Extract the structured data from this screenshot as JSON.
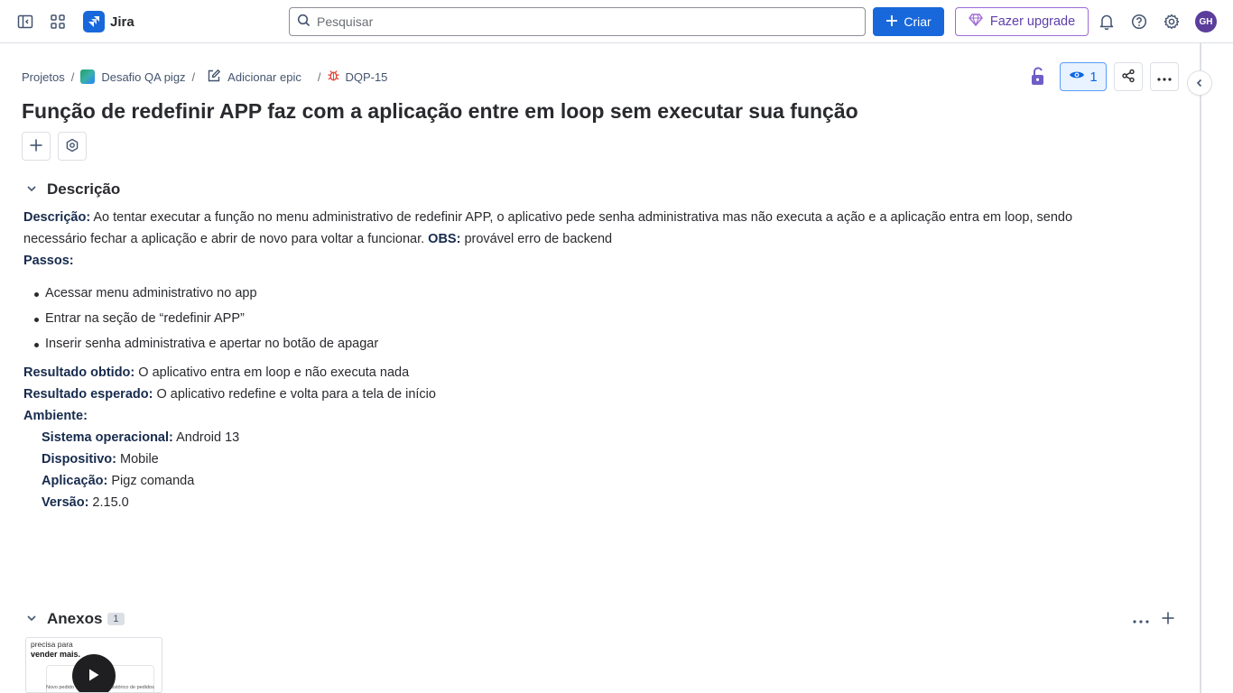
{
  "topbar": {
    "app_name": "Jira",
    "search_placeholder": "Pesquisar",
    "create_label": "Criar",
    "upgrade_label": "Fazer upgrade",
    "avatar_initials": "GH",
    "brand_color": "#1868db"
  },
  "breadcrumb": {
    "projects": "Projetos",
    "project": "Desafio QA pigz",
    "epic": "Adicionar epic",
    "issue_key": "DQP-15"
  },
  "actions": {
    "watchers_count": "1"
  },
  "issue": {
    "title": "Função de redefinir APP faz com a aplicação entre em loop sem executar sua função"
  },
  "description": {
    "heading": "Descrição",
    "desc_label": "Descrição:",
    "desc_text": " Ao tentar executar a função no menu administrativo de redefinir APP, o aplicativo pede senha administrativa mas não executa a ação e a aplicação entra em loop, sendo necessário fechar a aplicação e abrir de novo para voltar a funcionar.",
    "obs_label": "OBS:",
    "obs_text": " provável erro de backend",
    "steps_label": "Passos:",
    "steps": [
      "Acessar menu administrativo no app",
      "Entrar na seção de “redefinir APP”",
      "Inserir senha administrativa e apertar no botão de apagar"
    ],
    "obtained_label": "Resultado obtido:",
    "obtained_text": " O aplicativo entra em loop e não executa nada",
    "expected_label": "Resultado esperado:",
    "expected_text": " O aplicativo redefine e volta para a tela de início",
    "env_label": "Ambiente:",
    "os_label": "Sistema operacional:",
    "os_value": " Android 13",
    "device_label": "Dispositivo:",
    "device_value": " Mobile",
    "app_label": "Aplicação:",
    "app_value": " Pigz comanda",
    "version_label": "Versão:",
    "version_value": " 2.15.0"
  },
  "attachments": {
    "heading": "Anexos",
    "count": "1",
    "thumb_line1": "precisa para",
    "thumb_line2": "vender mais.",
    "thumb_caption1": "Novo pedido",
    "thumb_caption2": "Histórico de pedidos"
  }
}
